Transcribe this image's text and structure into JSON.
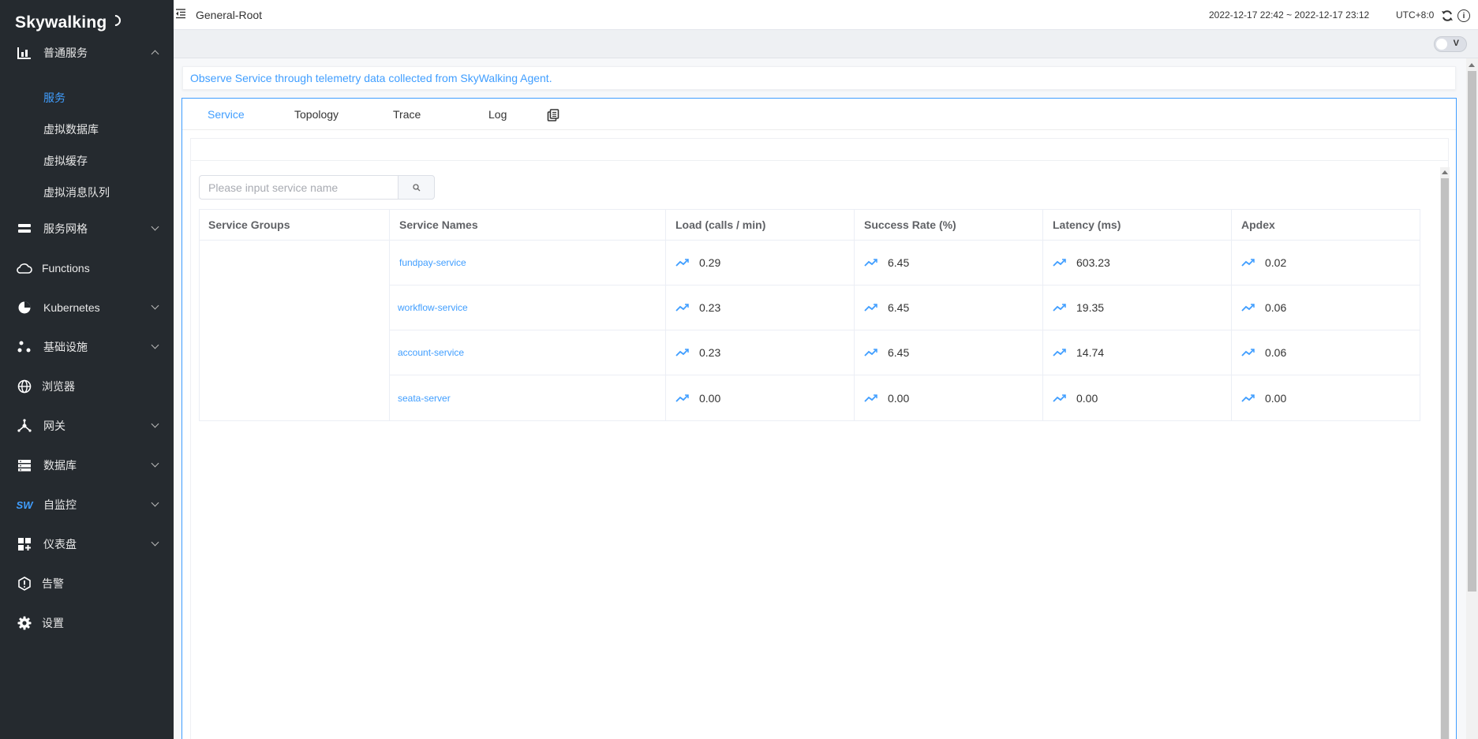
{
  "app": {
    "logo_text": "Skywalking"
  },
  "sidebar": {
    "items": [
      {
        "label": "普通服务",
        "icon": "bar-chart-icon",
        "expanded": true,
        "children": [
          {
            "label": "服务",
            "active": true
          },
          {
            "label": "虚拟数据库"
          },
          {
            "label": "虚拟缓存"
          },
          {
            "label": "虚拟消息队列"
          }
        ]
      },
      {
        "label": "服务网格",
        "icon": "layers-icon",
        "has_children": true
      },
      {
        "label": "Functions",
        "icon": "cloud-icon"
      },
      {
        "label": "Kubernetes",
        "icon": "pie-chart-icon",
        "has_children": true
      },
      {
        "label": "基础设施",
        "icon": "nodes-icon",
        "has_children": true
      },
      {
        "label": "浏览器",
        "icon": "globe-icon"
      },
      {
        "label": "网关",
        "icon": "gateway-icon",
        "has_children": true
      },
      {
        "label": "数据库",
        "icon": "database-icon",
        "has_children": true
      },
      {
        "label": "自监控",
        "icon": "sw-logo-icon",
        "icon_text": "SW",
        "has_children": true
      },
      {
        "label": "仪表盘",
        "icon": "dashboard-icon",
        "has_children": true
      },
      {
        "label": "告警",
        "icon": "alert-icon"
      },
      {
        "label": "设置",
        "icon": "gear-icon"
      }
    ]
  },
  "header": {
    "title": "General-Root",
    "time_range": "2022-12-17 22:42 ~ 2022-12-17 23:12",
    "timezone": "UTC+8:0",
    "toggle_label": "V"
  },
  "banner": {
    "text": "Observe Service through telemetry data collected from SkyWalking Agent."
  },
  "tabs": [
    {
      "label": "Service",
      "active": true
    },
    {
      "label": "Topology"
    },
    {
      "label": "Trace"
    },
    {
      "label": "Log"
    }
  ],
  "search": {
    "placeholder": "Please input service name",
    "value": ""
  },
  "table": {
    "columns": [
      "Service Groups",
      "Service Names",
      "Load (calls / min)",
      "Success Rate (%)",
      "Latency (ms)",
      "Apdex"
    ],
    "rows": [
      {
        "name": "fundpay-service",
        "load": "0.29",
        "success": "6.45",
        "latency": "603.23",
        "apdex": "0.02"
      },
      {
        "name": "workflow-service",
        "load": "0.23",
        "success": "6.45",
        "latency": "19.35",
        "apdex": "0.06"
      },
      {
        "name": "account-service",
        "load": "0.23",
        "success": "6.45",
        "latency": "14.74",
        "apdex": "0.06"
      },
      {
        "name": "seata-server",
        "load": "0.00",
        "success": "0.00",
        "latency": "0.00",
        "apdex": "0.00"
      }
    ]
  },
  "colors": {
    "sidebar_bg": "#252a2f",
    "accent": "#409eff",
    "text": "#333333"
  }
}
